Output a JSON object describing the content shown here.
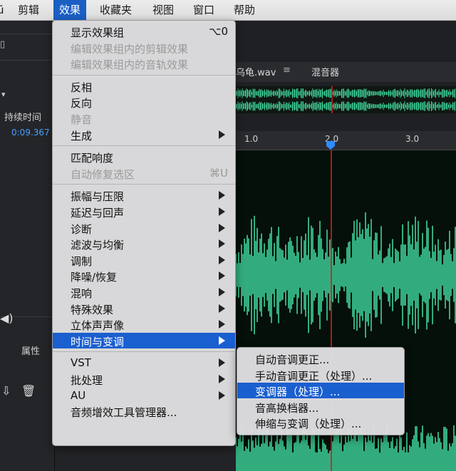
{
  "menubar": {
    "items": [
      {
        "label": "ũ",
        "active": false
      },
      {
        "label": "剪辑",
        "active": false
      },
      {
        "label": "效果",
        "active": true
      },
      {
        "label": "收藏夹",
        "active": false
      },
      {
        "label": "视图",
        "active": false
      },
      {
        "label": "窗口",
        "active": false
      },
      {
        "label": "帮助",
        "active": false
      }
    ]
  },
  "left_panel": {
    "duration_header": "持续时间",
    "duration_value": "0:09.367",
    "properties_label": "属性"
  },
  "editor": {
    "file_tab": "乌龟.wav",
    "mixer_tab": "混音器",
    "ruler_ticks": [
      "1.0",
      "2.0",
      "3.0"
    ]
  },
  "effects_menu": {
    "groups": [
      [
        {
          "label": "显示效果组",
          "shortcut": "⌥0",
          "disabled": false
        },
        {
          "label": "编辑效果组内的剪辑效果",
          "disabled": true
        },
        {
          "label": "编辑效果组内的音轨效果",
          "disabled": true
        }
      ],
      [
        {
          "label": "反相",
          "disabled": false
        },
        {
          "label": "反向",
          "disabled": false
        },
        {
          "label": "静音",
          "disabled": true
        },
        {
          "label": "生成",
          "disabled": false,
          "submenu": true
        }
      ],
      [
        {
          "label": "匹配响度",
          "disabled": false
        },
        {
          "label": "自动修复选区",
          "shortcut": "⌘U",
          "disabled": true
        }
      ],
      [
        {
          "label": "振幅与压限",
          "submenu": true
        },
        {
          "label": "延迟与回声",
          "submenu": true
        },
        {
          "label": "诊断",
          "submenu": true
        },
        {
          "label": "滤波与均衡",
          "submenu": true
        },
        {
          "label": "调制",
          "submenu": true
        },
        {
          "label": "降噪/恢复",
          "submenu": true
        },
        {
          "label": "混响",
          "submenu": true
        },
        {
          "label": "特殊效果",
          "submenu": true
        },
        {
          "label": "立体声声像",
          "submenu": true
        },
        {
          "label": "时间与变调",
          "submenu": true,
          "selected": true
        }
      ],
      [
        {
          "label": "VST",
          "submenu": true
        },
        {
          "label": "批处理",
          "submenu": true
        },
        {
          "label": "AU",
          "submenu": true
        },
        {
          "label": "音频增效工具管理器..."
        }
      ]
    ]
  },
  "time_pitch_submenu": {
    "items": [
      {
        "label": "自动音调更正...",
        "selected": false
      },
      {
        "label": "手动音调更正（处理）...",
        "selected": false
      },
      {
        "label": "变调器（处理）...",
        "selected": true
      },
      {
        "label": "音高换档器...",
        "selected": false
      },
      {
        "label": "伸缩与变调（处理）...",
        "selected": false
      }
    ]
  },
  "colors": {
    "waveform": "#3fd49a",
    "playhead": "#e02020",
    "menu_highlight": "#1a5fd0",
    "time_blue": "#4aa0ff"
  }
}
